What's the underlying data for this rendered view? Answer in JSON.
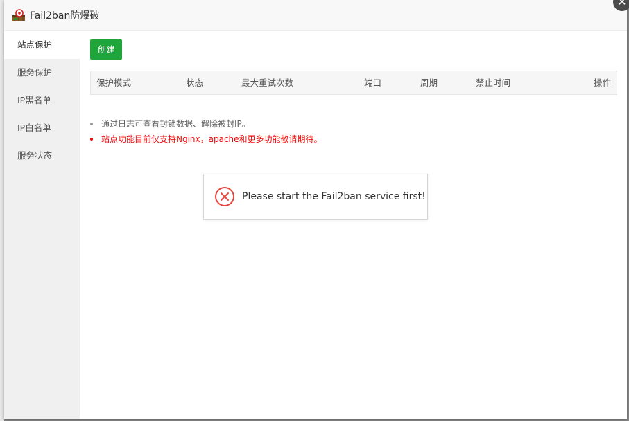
{
  "window": {
    "title": "Fail2ban防爆破",
    "logo_icon": "fail2ban-logo-icon",
    "close_icon": "close-icon"
  },
  "sidebar": {
    "items": [
      {
        "label": "站点保护",
        "active": true
      },
      {
        "label": "服务保护",
        "active": false
      },
      {
        "label": "IP黑名单",
        "active": false
      },
      {
        "label": "IP白名单",
        "active": false
      },
      {
        "label": "服务状态",
        "active": false
      }
    ]
  },
  "toolbar": {
    "create_label": "创建"
  },
  "table": {
    "columns": [
      "保护模式",
      "状态",
      "最大重试次数",
      "端口",
      "周期",
      "禁止时间",
      "操作"
    ],
    "rows": []
  },
  "tips": [
    {
      "text": "通过日志可查看封锁数据、解除被封IP。",
      "type": "info"
    },
    {
      "text": "站点功能目前仅支持Nginx，apache和更多功能敬请期待。",
      "type": "warning"
    }
  ],
  "toast": {
    "message": "Please start the Fail2ban service first!",
    "icon": "error-circle-icon"
  },
  "colors": {
    "accent_green": "#20a53a",
    "warning_red": "#ef0808",
    "error_icon_red": "#e8473e"
  }
}
